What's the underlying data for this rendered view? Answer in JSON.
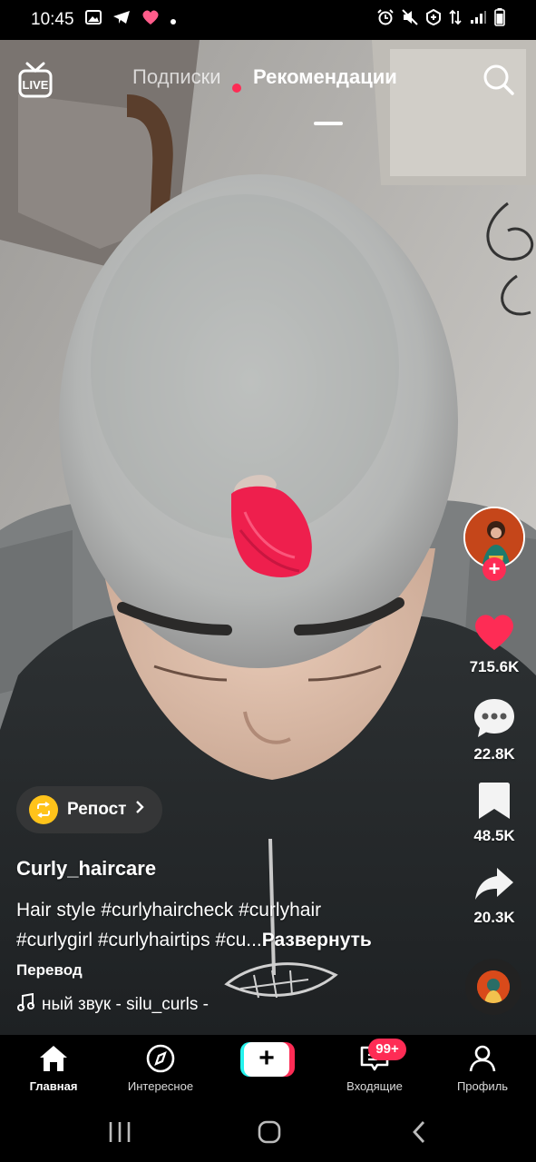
{
  "status_bar": {
    "time": "10:45",
    "left_icons": [
      "gallery-icon",
      "telegram-icon",
      "heart-icon",
      "dot-icon"
    ],
    "right_icons": [
      "alarm-icon",
      "mute-icon",
      "battery-saver-icon",
      "data-arrows-icon",
      "signal-icon",
      "battery-icon"
    ]
  },
  "top_bar": {
    "live_label": "LIVE",
    "tab_following": "Подписки",
    "tab_foryou": "Рекомендации",
    "active_tab": "Рекомендации"
  },
  "actions": {
    "likes": "715.6K",
    "comments": "22.8K",
    "saves": "48.5K",
    "shares": "20.3K"
  },
  "caption": {
    "repost_label": "Репост",
    "username": "Curly_haircare",
    "text_line1": "Hair style #curlyhaircheck #curlyhair",
    "text_line2": "#curlygirl #curlyhairtips #cu...",
    "expand_label": "Развернуть",
    "translate_label": "Перевод",
    "sound": "ный звук - silu_curls -"
  },
  "tab_bar": {
    "home": "Главная",
    "discover": "Интересное",
    "inbox": "Входящие",
    "inbox_badge": "99+",
    "profile": "Профиль"
  },
  "colors": {
    "accent": "#fe2c55",
    "cyan": "#25f4ee",
    "repost_yellow": "#ffc31a"
  }
}
